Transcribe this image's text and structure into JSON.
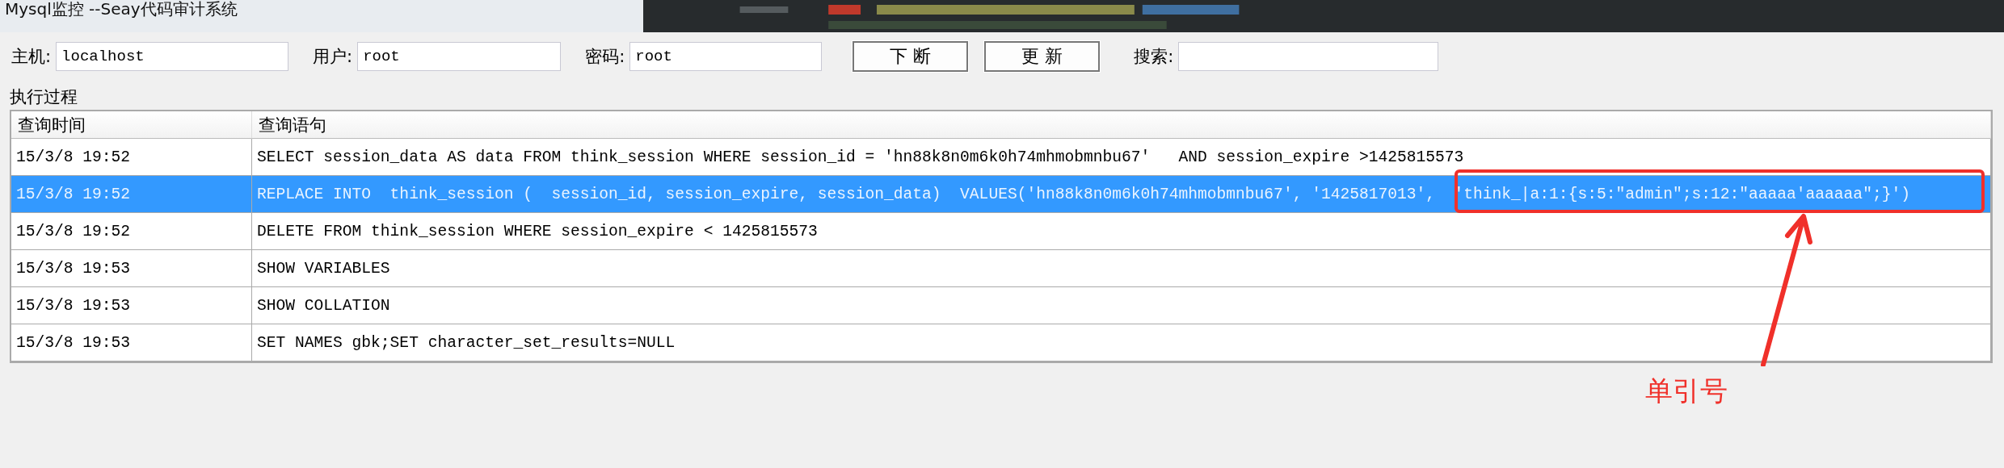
{
  "window": {
    "title": "Mysql监控 --Seay代码审计系统"
  },
  "toolbar": {
    "fields": [
      {
        "label": "主机:",
        "value": "localhost"
      },
      {
        "label": "用户:",
        "value": "root"
      },
      {
        "label": "密码:",
        "value": "root"
      }
    ],
    "buttons": [
      "下 断",
      "更 新"
    ],
    "search": {
      "label": "搜索:"
    }
  },
  "group": {
    "title": "执行过程"
  },
  "table": {
    "columns": [
      "查询时间",
      "查询语句"
    ],
    "rows": [
      {
        "time": "15/3/8 19:52",
        "query": "SELECT session_data AS data FROM think_session WHERE session_id = 'hn88k8n0m6k0h74mhmobmnbu67'   AND session_expire >1425815573",
        "selected": false
      },
      {
        "time": "15/3/8 19:52",
        "query": "REPLACE INTO  think_session (  session_id, session_expire, session_data)  VALUES('hn88k8n0m6k0h74mhmobmnbu67', '1425817013',  'think_|a:1:{s:5:\"admin\";s:12:\"aaaaa'aaaaaa\";}')",
        "selected": true
      },
      {
        "time": "15/3/8 19:52",
        "query": "DELETE FROM think_session WHERE session_expire < 1425815573",
        "selected": false
      },
      {
        "time": "15/3/8 19:53",
        "query": "SHOW VARIABLES",
        "selected": false
      },
      {
        "time": "15/3/8 19:53",
        "query": "SHOW COLLATION",
        "selected": false
      },
      {
        "time": "15/3/8 19:53",
        "query": "SET NAMES gbk;SET character_set_results=NULL",
        "selected": false
      }
    ]
  },
  "annotation": {
    "label": "单引号"
  }
}
